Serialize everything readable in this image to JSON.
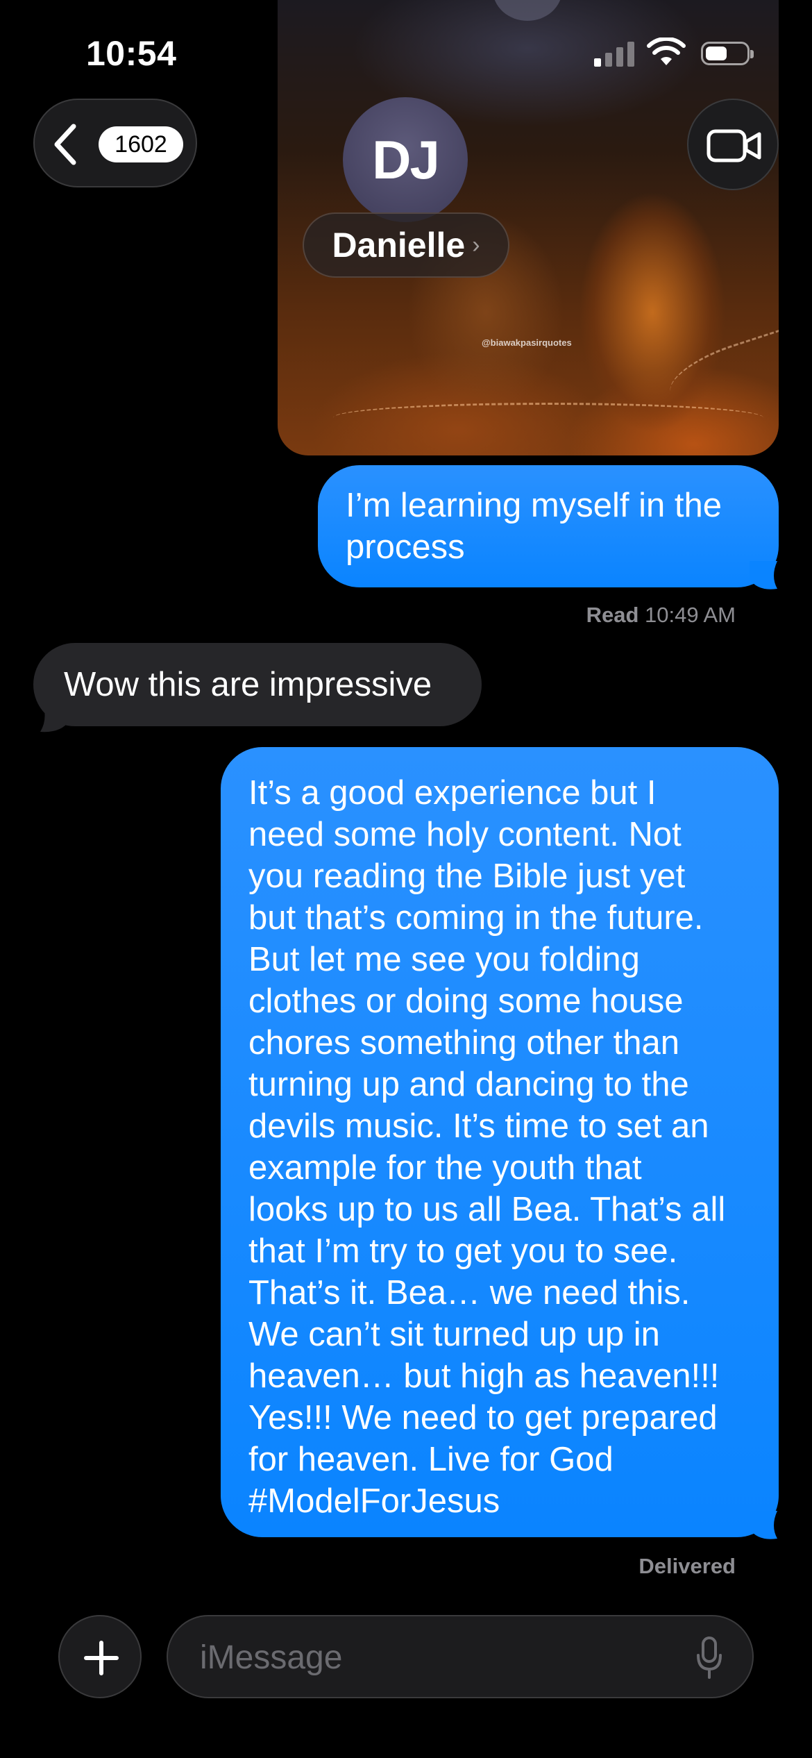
{
  "status_bar": {
    "time": "10:54"
  },
  "header": {
    "unread_count": "1602",
    "contact_initials": "DJ",
    "contact_name": "Danielle",
    "chevron": "›"
  },
  "attachment": {
    "watermark": "@biawakpasirquotes"
  },
  "messages": [
    {
      "direction": "outgoing",
      "lines": [
        "I’m learning myself in the",
        "process"
      ]
    },
    {
      "direction": "incoming",
      "text": "Wow this are impressive"
    },
    {
      "direction": "outgoing",
      "lines": [
        "It’s a good experience but I",
        "need some holy content. Not",
        "you reading the Bible just yet",
        "but that’s coming in the future.",
        "But let me see you folding",
        "clothes or doing some house",
        "chores something other than",
        "turning up and dancing to the",
        "devils music. It’s time to set an",
        "example for the youth that",
        "looks up to us all Bea. That’s all",
        "that I’m try to get you to see.",
        "That’s it. Bea… we need this.",
        "We can’t sit turned up up in",
        "heaven… but high as heaven!!!",
        "Yes!!! We need to get prepared",
        "for heaven. Live for God",
        "#ModelForJesus"
      ]
    }
  ],
  "read_receipt": {
    "label": "Read",
    "time": "10:49 AM"
  },
  "delivered_label": "Delivered",
  "composer": {
    "placeholder": "iMessage"
  },
  "icons": [
    "signal-icon",
    "wifi-icon",
    "battery-icon",
    "back-chevron-icon",
    "video-camera-icon",
    "plus-icon",
    "microphone-icon"
  ],
  "colors": {
    "outgoing_bubble": "#0a84ff",
    "incoming_bubble": "#262629",
    "background": "#000000",
    "meta_text": "#8e8e93"
  }
}
